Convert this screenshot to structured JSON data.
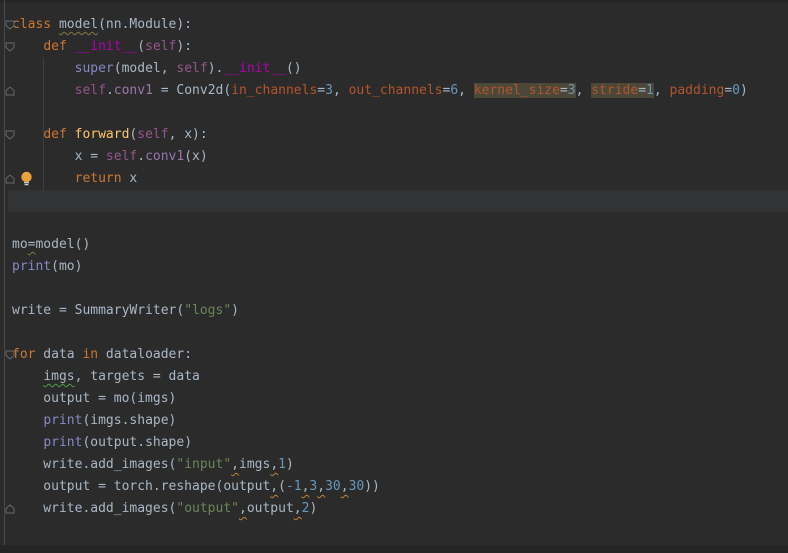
{
  "editor": {
    "colors": {
      "bg": "#2b2b2b",
      "txt": "#a9b7c6",
      "kw": "#cc7832",
      "builtin": "#8888c6",
      "self": "#94558d",
      "dunder": "#b200b2",
      "fn": "#ffc66b",
      "kwarg": "#b3552d",
      "num": "#6897bb",
      "str": "#6a8759",
      "attr": "#9876aa",
      "hlbg": "#4b4839",
      "wavyOlive": "#7f7a45",
      "wavyGreen": "#4c9e4c",
      "wavyWarn": "#c08437",
      "caretLine": "#313335",
      "foldStroke": "#66696b",
      "bulbFill": "#e9a23b"
    },
    "caret_line_row": 9,
    "code_lines": [
      {
        "row": 1,
        "tokens": [
          {
            "t": "class ",
            "c": "kw"
          },
          {
            "t": "model",
            "c": "txt",
            "u": "olive"
          },
          {
            "t": "(nn.Module):",
            "c": "txt"
          }
        ]
      },
      {
        "row": 2,
        "tokens": [
          {
            "t": "    ",
            "c": "txt"
          },
          {
            "t": "def ",
            "c": "kw"
          },
          {
            "t": "__init__",
            "c": "dunder"
          },
          {
            "t": "(",
            "c": "txt"
          },
          {
            "t": "self",
            "c": "self"
          },
          {
            "t": "):",
            "c": "txt"
          }
        ]
      },
      {
        "row": 3,
        "tokens": [
          {
            "t": "        ",
            "c": "txt"
          },
          {
            "t": "super",
            "c": "builtin"
          },
          {
            "t": "(model, ",
            "c": "txt"
          },
          {
            "t": "self",
            "c": "self"
          },
          {
            "t": ").",
            "c": "txt"
          },
          {
            "t": "__init__",
            "c": "dunder"
          },
          {
            "t": "()",
            "c": "txt"
          }
        ]
      },
      {
        "row": 4,
        "tokens": [
          {
            "t": "        ",
            "c": "txt"
          },
          {
            "t": "self",
            "c": "self"
          },
          {
            "t": ".",
            "c": "txt"
          },
          {
            "t": "conv1",
            "c": "attr"
          },
          {
            "t": " = Conv2d(",
            "c": "txt"
          },
          {
            "t": "in_channels",
            "c": "kwarg"
          },
          {
            "t": "=",
            "c": "txt"
          },
          {
            "t": "3",
            "c": "num"
          },
          {
            "t": ", ",
            "c": "txt"
          },
          {
            "t": "out_channels",
            "c": "kwarg"
          },
          {
            "t": "=",
            "c": "txt"
          },
          {
            "t": "6",
            "c": "num"
          },
          {
            "t": ", ",
            "c": "txt"
          },
          {
            "t": "kernel_size",
            "c": "kwarg",
            "bg": true
          },
          {
            "t": "=",
            "c": "txt",
            "bg": true
          },
          {
            "t": "3",
            "c": "num",
            "bg": true
          },
          {
            "t": ", ",
            "c": "txt"
          },
          {
            "t": "stride",
            "c": "kwarg",
            "bg": true
          },
          {
            "t": "=",
            "c": "txt",
            "bg": true
          },
          {
            "t": "1",
            "c": "num",
            "bg": true
          },
          {
            "t": ", ",
            "c": "txt"
          },
          {
            "t": "padding",
            "c": "kwarg"
          },
          {
            "t": "=",
            "c": "txt"
          },
          {
            "t": "0",
            "c": "num"
          },
          {
            "t": ")",
            "c": "txt"
          }
        ]
      },
      {
        "row": 6,
        "tokens": [
          {
            "t": "    ",
            "c": "txt"
          },
          {
            "t": "def ",
            "c": "kw"
          },
          {
            "t": "forward",
            "c": "fn"
          },
          {
            "t": "(",
            "c": "txt"
          },
          {
            "t": "self",
            "c": "self"
          },
          {
            "t": ", x):",
            "c": "txt"
          }
        ]
      },
      {
        "row": 7,
        "tokens": [
          {
            "t": "        x = ",
            "c": "txt"
          },
          {
            "t": "self",
            "c": "self"
          },
          {
            "t": ".",
            "c": "txt"
          },
          {
            "t": "conv1",
            "c": "attr"
          },
          {
            "t": "(x)",
            "c": "txt"
          }
        ]
      },
      {
        "row": 8,
        "tokens": [
          {
            "t": "        ",
            "c": "txt"
          },
          {
            "t": "return",
            "c": "kw"
          },
          {
            "t": " x",
            "c": "txt"
          }
        ]
      },
      {
        "row": 11,
        "tokens": [
          {
            "t": "mo",
            "c": "txt"
          },
          {
            "t": "=",
            "c": "txt",
            "u": "olive"
          },
          {
            "t": "model()",
            "c": "txt"
          }
        ]
      },
      {
        "row": 12,
        "tokens": [
          {
            "t": "print",
            "c": "builtin"
          },
          {
            "t": "(mo)",
            "c": "txt"
          }
        ]
      },
      {
        "row": 14,
        "tokens": [
          {
            "t": "write = SummaryWriter(",
            "c": "txt"
          },
          {
            "t": "\"logs\"",
            "c": "str"
          },
          {
            "t": ")",
            "c": "txt"
          }
        ]
      },
      {
        "row": 16,
        "tokens": [
          {
            "t": "for",
            "c": "kw"
          },
          {
            "t": " data ",
            "c": "txt"
          },
          {
            "t": "in",
            "c": "kw"
          },
          {
            "t": " dataloader:",
            "c": "txt"
          }
        ]
      },
      {
        "row": 17,
        "tokens": [
          {
            "t": "    ",
            "c": "txt"
          },
          {
            "t": "imgs",
            "c": "txt",
            "u": "green"
          },
          {
            "t": ", targets = data",
            "c": "txt"
          }
        ]
      },
      {
        "row": 18,
        "tokens": [
          {
            "t": "    output = mo(imgs)",
            "c": "txt"
          }
        ]
      },
      {
        "row": 19,
        "tokens": [
          {
            "t": "    ",
            "c": "txt"
          },
          {
            "t": "print",
            "c": "builtin"
          },
          {
            "t": "(imgs.shape)",
            "c": "txt"
          }
        ]
      },
      {
        "row": 20,
        "tokens": [
          {
            "t": "    ",
            "c": "txt"
          },
          {
            "t": "print",
            "c": "builtin"
          },
          {
            "t": "(output.shape)",
            "c": "txt"
          }
        ]
      },
      {
        "row": 21,
        "tokens": [
          {
            "t": "    write.add_images(",
            "c": "txt"
          },
          {
            "t": "\"input\"",
            "c": "str"
          },
          {
            "t": ",",
            "c": "txt",
            "u": "warn"
          },
          {
            "t": "imgs",
            "c": "txt"
          },
          {
            "t": ",",
            "c": "txt",
            "u": "warn"
          },
          {
            "t": "1",
            "c": "num"
          },
          {
            "t": ")",
            "c": "txt"
          }
        ]
      },
      {
        "row": 22,
        "tokens": [
          {
            "t": "    output = torch.reshape(output",
            "c": "txt"
          },
          {
            "t": ",",
            "c": "txt",
            "u": "warn"
          },
          {
            "t": "(",
            "c": "txt"
          },
          {
            "t": "-1",
            "c": "num"
          },
          {
            "t": ",",
            "c": "txt",
            "u": "warn"
          },
          {
            "t": "3",
            "c": "num"
          },
          {
            "t": ",",
            "c": "txt",
            "u": "warn"
          },
          {
            "t": "30",
            "c": "num"
          },
          {
            "t": ",",
            "c": "txt",
            "u": "warn"
          },
          {
            "t": "30",
            "c": "num"
          },
          {
            "t": "))",
            "c": "txt"
          }
        ]
      },
      {
        "row": 23,
        "tokens": [
          {
            "t": "    write.add_images(",
            "c": "txt"
          },
          {
            "t": "\"output\"",
            "c": "str"
          },
          {
            "t": ",",
            "c": "txt",
            "u": "warn"
          },
          {
            "t": "output",
            "c": "txt"
          },
          {
            "t": ",",
            "c": "txt",
            "u": "warn"
          },
          {
            "t": "2",
            "c": "num"
          },
          {
            "t": ")",
            "c": "txt"
          }
        ]
      }
    ],
    "gutter": {
      "fold_markers": [
        {
          "row": 1,
          "type": "start",
          "icon": "fold-collapse-icon"
        },
        {
          "row": 2,
          "type": "start",
          "icon": "fold-collapse-icon"
        },
        {
          "row": 4,
          "type": "end",
          "icon": "fold-end-icon"
        },
        {
          "row": 6,
          "type": "start",
          "icon": "fold-collapse-icon"
        },
        {
          "row": 8,
          "type": "end",
          "icon": "fold-end-icon"
        },
        {
          "row": 16,
          "type": "start",
          "icon": "fold-collapse-icon"
        },
        {
          "row": 23,
          "type": "end",
          "icon": "fold-end-icon"
        }
      ],
      "bulb_row": 8,
      "bulb_icon": "lightbulb-icon"
    }
  }
}
